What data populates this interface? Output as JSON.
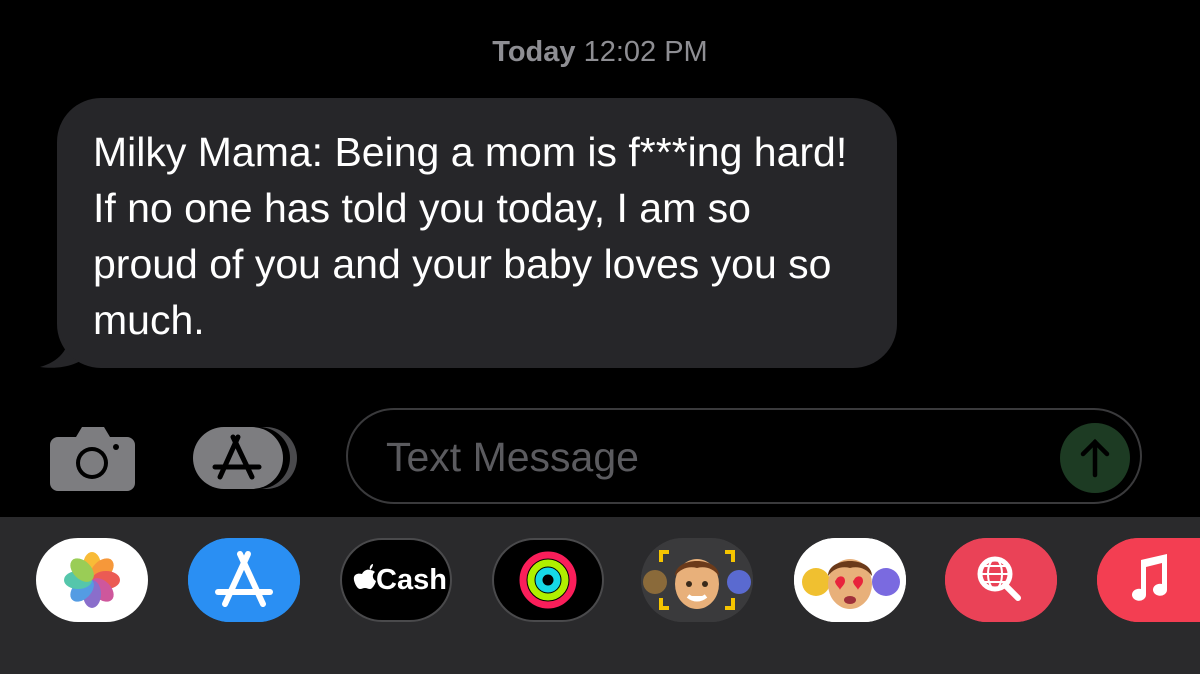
{
  "header": {
    "day": "Today",
    "time": "12:02 PM"
  },
  "message": {
    "text": "Milky Mama: Being a mom is f***ing hard! If no one has told you today, I am so proud of you and your baby loves you so much."
  },
  "input": {
    "placeholder": "Text Message"
  },
  "app_tray": {
    "items": [
      {
        "name": "photos-app-icon"
      },
      {
        "name": "app-store-icon"
      },
      {
        "name": "apple-cash-icon",
        "label": "Cash"
      },
      {
        "name": "activity-icon"
      },
      {
        "name": "memoji-stickers-icon"
      },
      {
        "name": "animoji-icon"
      },
      {
        "name": "image-search-icon"
      },
      {
        "name": "music-icon"
      }
    ]
  },
  "colors": {
    "background": "#000000",
    "bubble": "#262629",
    "timestamp": "#8e8e93",
    "tray": "#2a2a2c",
    "send_button": "#1d3b23"
  }
}
